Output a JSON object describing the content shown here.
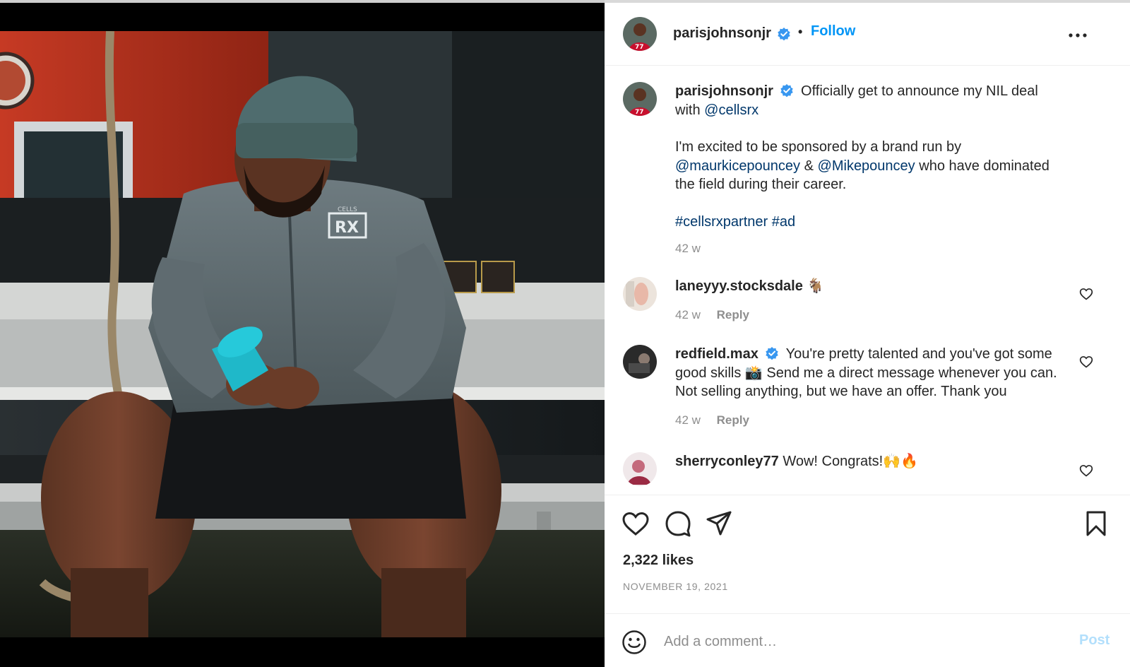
{
  "post": {
    "author": "parisjohnsonjr",
    "follow_label": "Follow",
    "dot": "•",
    "caption": {
      "line1": "Officially get to announce my NIL deal",
      "with_word": "with",
      "mention_brand": "@cellsrx",
      "para2_a": "I'm excited to be sponsored by a brand run by",
      "mention_1": "@maurkicepouncey",
      "amp": "&",
      "mention_2": "@Mikepouncey",
      "para2_b": "who have dominated",
      "para2_c": "the field during their career.",
      "hashtag_1": "#cellsrxpartner",
      "hashtag_2": "#ad",
      "time": "42 w"
    },
    "likes": "2,322 likes",
    "date": "NOVEMBER 19, 2021"
  },
  "comments": [
    {
      "user": "laneyyy.stocksdale",
      "text": "🐐",
      "time": "42 w",
      "reply": "Reply"
    },
    {
      "user": "redfield.max",
      "verified": true,
      "text_a": "You're pretty talented and you've got some",
      "text_b": "good skills 📸 Send me a direct message whenever you can.",
      "text_c": "Not selling anything, but we have an offer. Thank you",
      "time": "42 w",
      "reply": "Reply"
    },
    {
      "user": "sherryconley77",
      "text": "Wow! Congrats!🙌🔥"
    }
  ],
  "composer": {
    "placeholder": "Add a comment…",
    "post_label": "Post"
  },
  "photo": {
    "logo_text": "RX",
    "logo_small": "CELLS"
  },
  "colors": {
    "accent": "#0095f6",
    "link": "#00376b",
    "verified": "#3897f0",
    "muted": "#8e8e8e"
  }
}
